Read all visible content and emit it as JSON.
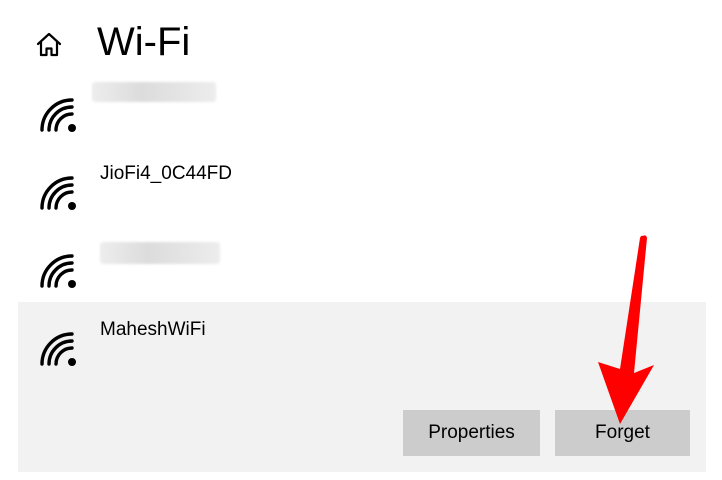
{
  "page": {
    "title": "Wi-Fi",
    "home_icon": "home-icon"
  },
  "networks": [
    {
      "name": "",
      "icon": "wifi-signal-icon"
    },
    {
      "name": "JioFi4_0C44FD",
      "icon": "wifi-signal-icon"
    },
    {
      "name": "",
      "icon": "wifi-signal-icon"
    },
    {
      "name": "MaheshWiFi",
      "icon": "wifi-signal-icon",
      "selected": true
    }
  ],
  "actions": {
    "properties_label": "Properties",
    "forget_label": "Forget"
  },
  "colors": {
    "selected_row_bg": "#f2f2f2",
    "button_bg": "#cccccc",
    "annotation_arrow": "#ff0000"
  }
}
